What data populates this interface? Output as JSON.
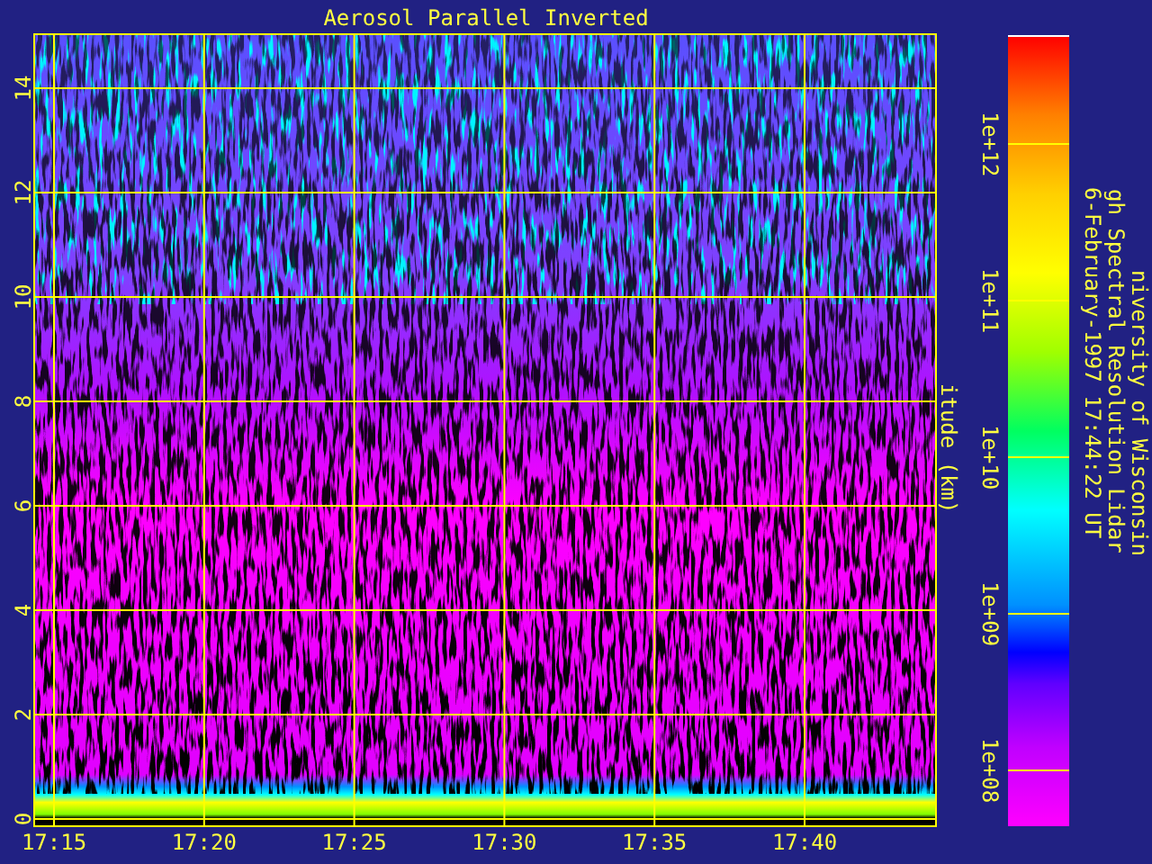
{
  "title": "Aerosol Parallel Inverted",
  "plot": {
    "y_tick_labels": [
      "0",
      "2",
      "4",
      "6",
      "8",
      "10",
      "12",
      "14"
    ],
    "x_tick_labels": [
      "17:15",
      "17:20",
      "17:25",
      "17:30",
      "17:35",
      "17:40"
    ],
    "y_axis_label": "itude (km)"
  },
  "color_scale": {
    "tick_labels": [
      "1e+12",
      "1e+11",
      "1e+10",
      "1e+09",
      "1e+08"
    ]
  },
  "caption_lines": [
    "niversity of Wisconsin",
    "gh Spectral Resolution Lidar",
    "6-February-1997 17:44:22 UT"
  ]
}
